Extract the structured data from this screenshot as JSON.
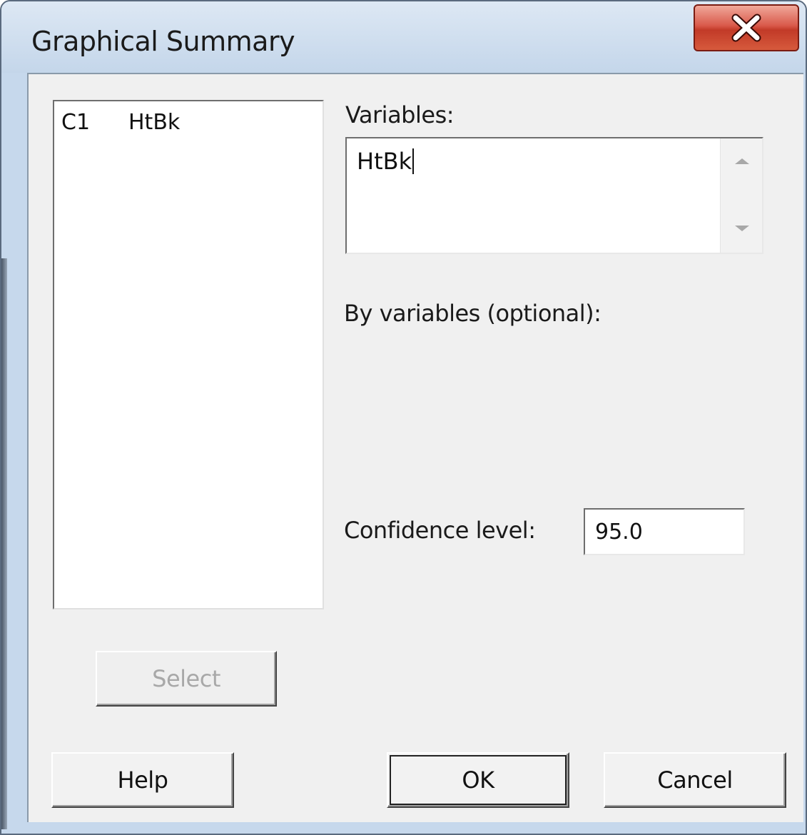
{
  "window": {
    "title": "Graphical Summary"
  },
  "columns_list": [
    {
      "id": "C1",
      "name": "HtBk"
    }
  ],
  "variables": {
    "label": "Variables:",
    "value": "HtBk"
  },
  "by_variables": {
    "label": "By variables (optional):"
  },
  "confidence": {
    "label": "Confidence level:",
    "value": "95.0"
  },
  "buttons": {
    "select": "Select",
    "help": "Help",
    "ok": "OK",
    "cancel": "Cancel"
  }
}
